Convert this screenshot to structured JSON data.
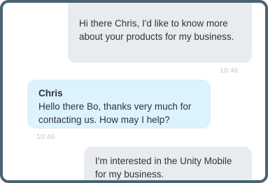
{
  "messages": [
    {
      "direction": "outgoing",
      "text": "Hi there Chris, I'd like to know more about your products for my business.",
      "time": "10:46"
    },
    {
      "direction": "incoming",
      "sender": "Chris",
      "text": "Hello there Bo, thanks very much for contacting us. How may I help?",
      "time": "10:46"
    },
    {
      "direction": "outgoing",
      "text": "I'm interested in the Unity Mobile for my business."
    }
  ],
  "colors": {
    "frame_border": "#4b6272",
    "outgoing_bubble": "#e9ecef",
    "incoming_bubble": "#dcf2fd",
    "timestamp": "#c4c8cc"
  }
}
